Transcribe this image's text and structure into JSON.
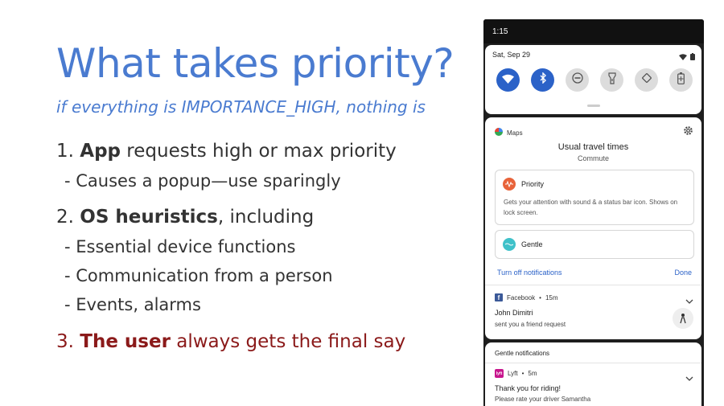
{
  "slide": {
    "title": "What takes priority?",
    "subtitle": "if everything is IMPORTANCE_HIGH, nothing is",
    "items": [
      {
        "prefix": "1. ",
        "bold": "App",
        "rest": " requests high or max priority"
      },
      {
        "sub": "- Causes a popup—use sparingly"
      },
      {
        "prefix": "2. ",
        "bold": "OS heuristics",
        "rest": ", including"
      },
      {
        "sub": "- Essential device functions"
      },
      {
        "sub": "- Communication from a person"
      },
      {
        "sub": "- Events, alarms"
      },
      {
        "prefix": "3. ",
        "bold": "The user",
        "rest": " always gets the final say"
      }
    ],
    "accent_color": "#4a7bd0",
    "emphasis_color": "#8b1a1a"
  },
  "phone": {
    "status_time": "1:15",
    "quick_settings": {
      "date": "Sat, Sep 29",
      "tiles": [
        {
          "icon": "wifi-icon",
          "on": true
        },
        {
          "icon": "bluetooth-icon",
          "on": true
        },
        {
          "icon": "do-not-disturb-icon",
          "on": false
        },
        {
          "icon": "flashlight-icon",
          "on": false
        },
        {
          "icon": "auto-rotate-icon",
          "on": false
        },
        {
          "icon": "battery-saver-icon",
          "on": false
        }
      ]
    },
    "maps_notification": {
      "app_name": "Maps",
      "title": "Usual travel times",
      "subtitle": "Commute",
      "priority_label": "Priority",
      "priority_desc": "Gets your attention with sound & a status bar icon. Shows on lock screen.",
      "gentle_label": "Gentle",
      "turn_off": "Turn off notifications",
      "done": "Done"
    },
    "facebook_notification": {
      "app_name": "Facebook",
      "time": "15m",
      "sender": "John Dimitri",
      "message": "sent you a friend request"
    },
    "gentle_section": {
      "header": "Gentle notifications",
      "app_name": "Lyft",
      "time": "5m",
      "title": "Thank you for riding!",
      "message": "Please rate your driver Samantha"
    }
  }
}
